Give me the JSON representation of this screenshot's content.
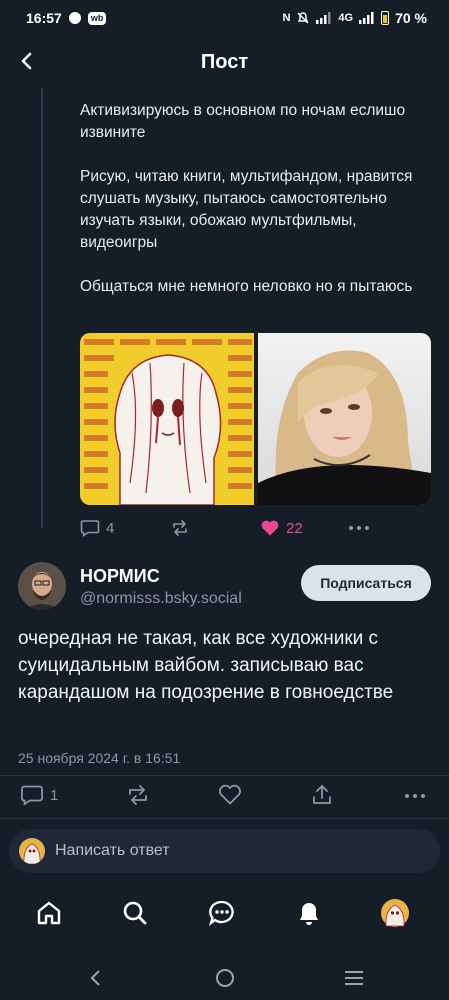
{
  "status_bar": {
    "time": "16:57",
    "network": "4G",
    "battery": "70 %",
    "app_badge": "wb"
  },
  "header": {
    "title": "Пост"
  },
  "parent_post": {
    "paragraphs": [
      "Активизируюсь в основном по ночам еслишо извините",
      "Рисую, читаю книги, мультифандом, нравится слушать музыку, пытаюсь самостоятельно изучать языки, обожаю мультфильмы, видеоигры",
      "Общаться мне немного неловко но я пытаюсь"
    ],
    "replies": "4",
    "likes": "22",
    "like_color": "#ec4899"
  },
  "main_post": {
    "author_name": "НОРМИС",
    "author_handle": "@normisss.bsky.social",
    "follow_label": "Подписаться",
    "text": "очередная не такая, как все художники с суицидальным вайбом. записываю вас карандашом на подозрение в говноедстве",
    "date": "25 ноября 2024 г. в 16:51",
    "replies": "1"
  },
  "reply_box": {
    "placeholder": "Написать ответ"
  },
  "nav": {
    "items": [
      "home-icon",
      "search-icon",
      "chat-icon",
      "bell-icon",
      "profile-avatar"
    ]
  },
  "colors": {
    "background": "#151d27",
    "muted": "#8a97a8",
    "accent_like": "#ec4899"
  }
}
